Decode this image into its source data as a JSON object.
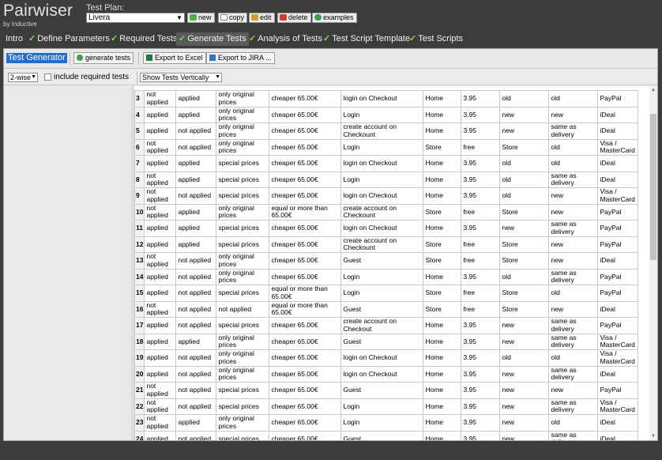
{
  "app": {
    "name": "Pairwiser",
    "byline": "by Inductive"
  },
  "test_plan": {
    "label": "Test Plan:",
    "selected": "Livera",
    "buttons": {
      "new": "new",
      "copy": "copy",
      "edit": "edit",
      "delete": "delete",
      "examples": "examples"
    }
  },
  "tabs": [
    {
      "label": "Intro",
      "checked": false
    },
    {
      "label": "Define Parameters",
      "checked": true
    },
    {
      "label": "Required Tests",
      "checked": true
    },
    {
      "label": "Generate Tests",
      "checked": true
    },
    {
      "label": "Analysis of Tests",
      "checked": true
    },
    {
      "label": "Test Script Template",
      "checked": true
    },
    {
      "label": "Test Scripts",
      "checked": true
    }
  ],
  "toolbar": {
    "title": "Test Generator",
    "generate_label": "generate tests",
    "excel_label": "Export to Excel",
    "jira_label": "Export to JIRA ..."
  },
  "options": {
    "wise": "2-wise",
    "include_required": "include required tests",
    "show": "Show Tests Vertically"
  },
  "colors": {
    "accent": "#1f6fd6",
    "check": "#7ddc5a"
  },
  "rows": [
    [
      "3",
      "not applied",
      "applied",
      "only original prices",
      "cheaper 65.00€",
      "login on Checkout",
      "Home",
      "3.95",
      "old",
      "old",
      "PayPal"
    ],
    [
      "4",
      "applied",
      "applied",
      "only original prices",
      "cheaper 65.00€",
      "Login",
      "Home",
      "3.95",
      "new",
      "new",
      "iDeal"
    ],
    [
      "5",
      "applied",
      "not applied",
      "only original prices",
      "cheaper 65.00€",
      "create account on Checkount",
      "Home",
      "3.95",
      "new",
      "same as delivery",
      "iDeal"
    ],
    [
      "6",
      "not applied",
      "not applied",
      "only original prices",
      "cheaper 65.00€",
      "Login",
      "Store",
      "free",
      "Store",
      "old",
      "Visa / MasterCard"
    ],
    [
      "7",
      "applied",
      "applied",
      "special prices",
      "cheaper 65.00€",
      "login on Checkout",
      "Home",
      "3.95",
      "old",
      "old",
      "iDeal"
    ],
    [
      "8",
      "not applied",
      "applied",
      "special prices",
      "cheaper 65.00€",
      "Login",
      "Home",
      "3.95",
      "old",
      "same as delivery",
      "iDeal"
    ],
    [
      "9",
      "not applied",
      "not applied",
      "special prices",
      "cheaper 65.00€",
      "login on Checkout",
      "Home",
      "3.95",
      "old",
      "new",
      "Visa / MasterCard"
    ],
    [
      "10",
      "not applied",
      "applied",
      "only original prices",
      "equal or more than 65.00€",
      "create account on Checkount",
      "Store",
      "free",
      "Store",
      "new",
      "PayPal"
    ],
    [
      "11",
      "applied",
      "applied",
      "special prices",
      "cheaper 65.00€",
      "login on Checkout",
      "Home",
      "3.95",
      "new",
      "same as delivery",
      "PayPal"
    ],
    [
      "12",
      "applied",
      "applied",
      "special prices",
      "cheaper 65.00€",
      "create account on Checkount",
      "Store",
      "free",
      "Store",
      "new",
      "PayPal"
    ],
    [
      "13",
      "not applied",
      "not applied",
      "only original prices",
      "cheaper 65.00€",
      "Guest",
      "Store",
      "free",
      "Store",
      "new",
      "iDeal"
    ],
    [
      "14",
      "applied",
      "not applied",
      "only original prices",
      "cheaper 65.00€",
      "Login",
      "Home",
      "3.95",
      "old",
      "same as delivery",
      "PayPal"
    ],
    [
      "15",
      "applied",
      "not applied",
      "special prices",
      "equal or more than 65.00€",
      "Login",
      "Store",
      "free",
      "Store",
      "old",
      "PayPal"
    ],
    [
      "16",
      "not applied",
      "not applied",
      "not applied",
      "equal or more than 65.00€",
      "Guest",
      "Store",
      "free",
      "Store",
      "new",
      "iDeal"
    ],
    [
      "17",
      "applied",
      "not applied",
      "special prices",
      "cheaper 65.00€",
      "create account on Checkout",
      "Home",
      "3.95",
      "new",
      "same as delivery",
      "PayPal"
    ],
    [
      "18",
      "applied",
      "applied",
      "only original prices",
      "cheaper 65.00€",
      "Guest",
      "Home",
      "3.95",
      "new",
      "same as delivery",
      "Visa / MasterCard"
    ],
    [
      "19",
      "applied",
      "not applied",
      "only original prices",
      "cheaper 65.00€",
      "login on Checkout",
      "Home",
      "3.95",
      "old",
      "old",
      "Visa / MasterCard"
    ],
    [
      "20",
      "applied",
      "not applied",
      "only original prices",
      "cheaper 65.00€",
      "login on Checkout",
      "Home",
      "3.95",
      "new",
      "same as delivery",
      "iDeal"
    ],
    [
      "21",
      "not applied",
      "not applied",
      "special prices",
      "cheaper 65.00€",
      "Guest",
      "Home",
      "3.95",
      "new",
      "new",
      "PayPal"
    ],
    [
      "22",
      "not applied",
      "not applied",
      "special prices",
      "cheaper 65.00€",
      "Login",
      "Home",
      "3.95",
      "new",
      "same as delivery",
      "Visa / MasterCard"
    ],
    [
      "23",
      "not applied",
      "applied",
      "only original prices",
      "cheaper 65.00€",
      "Login",
      "Home",
      "3.95",
      "new",
      "old",
      "iDeal"
    ],
    [
      "24",
      "applied",
      "not applied",
      "special prices",
      "cheaper 65.00€",
      "Guest",
      "Home",
      "3.95",
      "new",
      "same as delivery",
      "iDeal"
    ]
  ]
}
